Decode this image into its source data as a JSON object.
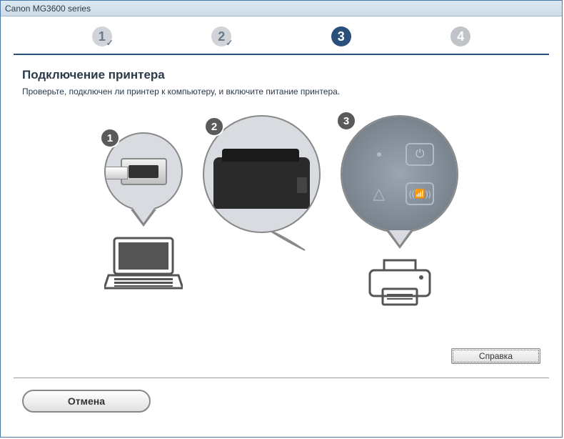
{
  "window": {
    "title": "Canon MG3600 series"
  },
  "steps": {
    "step1": "1",
    "step2": "2",
    "step3": "3",
    "step4": "4"
  },
  "page": {
    "title": "Подключение принтера",
    "description": "Проверьте, подключен ли принтер к компьютеру, и включите питание принтера."
  },
  "badges": {
    "b1": "1",
    "b2": "2",
    "b3": "3"
  },
  "buttons": {
    "help": "Справка",
    "cancel": "Отмена"
  }
}
